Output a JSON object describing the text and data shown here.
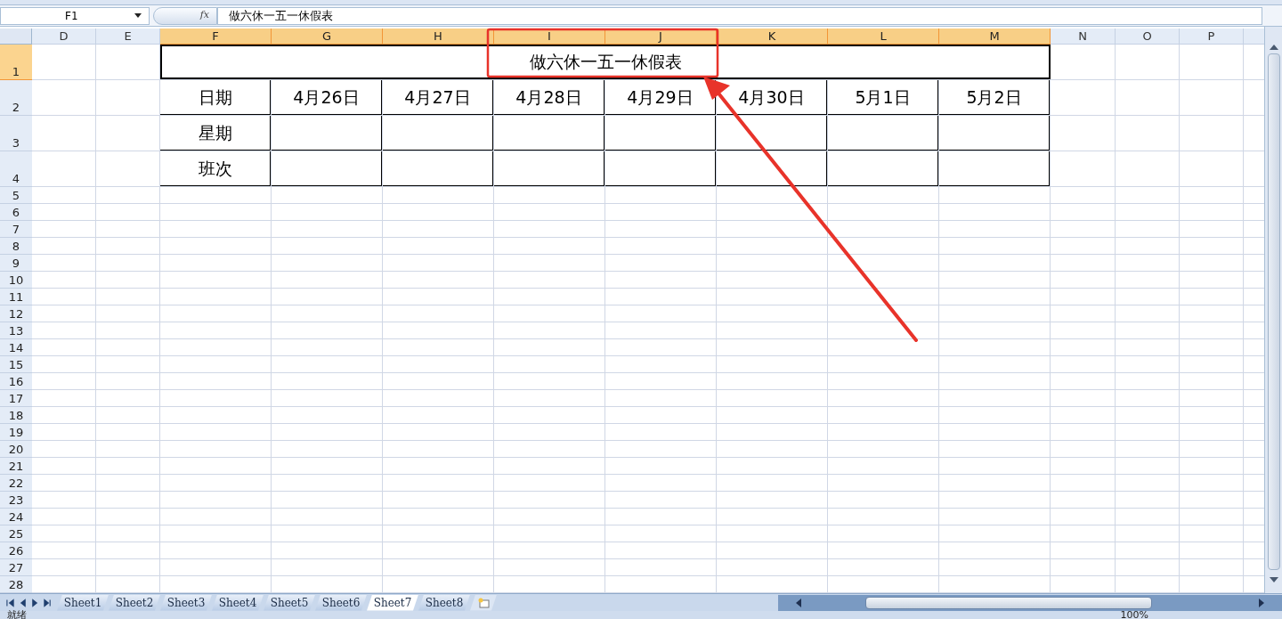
{
  "formula_bar": {
    "name_box": "F1",
    "fx": "fx",
    "content": "做六休一五一休假表"
  },
  "columns": [
    {
      "label": "D",
      "selected": false
    },
    {
      "label": "E",
      "selected": false
    },
    {
      "label": "F",
      "selected": true
    },
    {
      "label": "G",
      "selected": true
    },
    {
      "label": "H",
      "selected": true
    },
    {
      "label": "I",
      "selected": true
    },
    {
      "label": "J",
      "selected": true
    },
    {
      "label": "K",
      "selected": true
    },
    {
      "label": "L",
      "selected": true
    },
    {
      "label": "M",
      "selected": true
    },
    {
      "label": "N",
      "selected": false
    },
    {
      "label": "O",
      "selected": false
    },
    {
      "label": "P",
      "selected": false
    }
  ],
  "rows": [
    {
      "label": "1",
      "selected": true
    },
    {
      "label": "2",
      "selected": false
    },
    {
      "label": "3",
      "selected": false
    },
    {
      "label": "4",
      "selected": false
    },
    {
      "label": "5",
      "selected": false
    },
    {
      "label": "6",
      "selected": false
    },
    {
      "label": "7",
      "selected": false
    },
    {
      "label": "8",
      "selected": false
    },
    {
      "label": "9",
      "selected": false
    },
    {
      "label": "10",
      "selected": false
    },
    {
      "label": "11",
      "selected": false
    },
    {
      "label": "12",
      "selected": false
    },
    {
      "label": "13",
      "selected": false
    },
    {
      "label": "14",
      "selected": false
    },
    {
      "label": "15",
      "selected": false
    },
    {
      "label": "16",
      "selected": false
    },
    {
      "label": "17",
      "selected": false
    },
    {
      "label": "18",
      "selected": false
    },
    {
      "label": "19",
      "selected": false
    },
    {
      "label": "20",
      "selected": false
    },
    {
      "label": "21",
      "selected": false
    },
    {
      "label": "22",
      "selected": false
    },
    {
      "label": "23",
      "selected": false
    },
    {
      "label": "24",
      "selected": false
    },
    {
      "label": "25",
      "selected": false
    },
    {
      "label": "26",
      "selected": false
    },
    {
      "label": "27",
      "selected": false
    },
    {
      "label": "28",
      "selected": false
    }
  ],
  "table": {
    "title": "做六休一五一休假表",
    "header": [
      "日期",
      "4月26日",
      "4月27日",
      "4月28日",
      "4月29日",
      "4月30日",
      "5月1日",
      "5月2日"
    ],
    "row_labels": [
      "星期",
      "班次"
    ]
  },
  "sheet_tabs": [
    {
      "label": "Sheet1",
      "selected": false
    },
    {
      "label": "Sheet2",
      "selected": false
    },
    {
      "label": "Sheet3",
      "selected": false
    },
    {
      "label": "Sheet4",
      "selected": false
    },
    {
      "label": "Sheet5",
      "selected": false
    },
    {
      "label": "Sheet6",
      "selected": false
    },
    {
      "label": "Sheet7",
      "selected": true
    },
    {
      "label": "Sheet8",
      "selected": false
    }
  ],
  "status_bar": {
    "status": "就绪",
    "zoom": "100%"
  }
}
